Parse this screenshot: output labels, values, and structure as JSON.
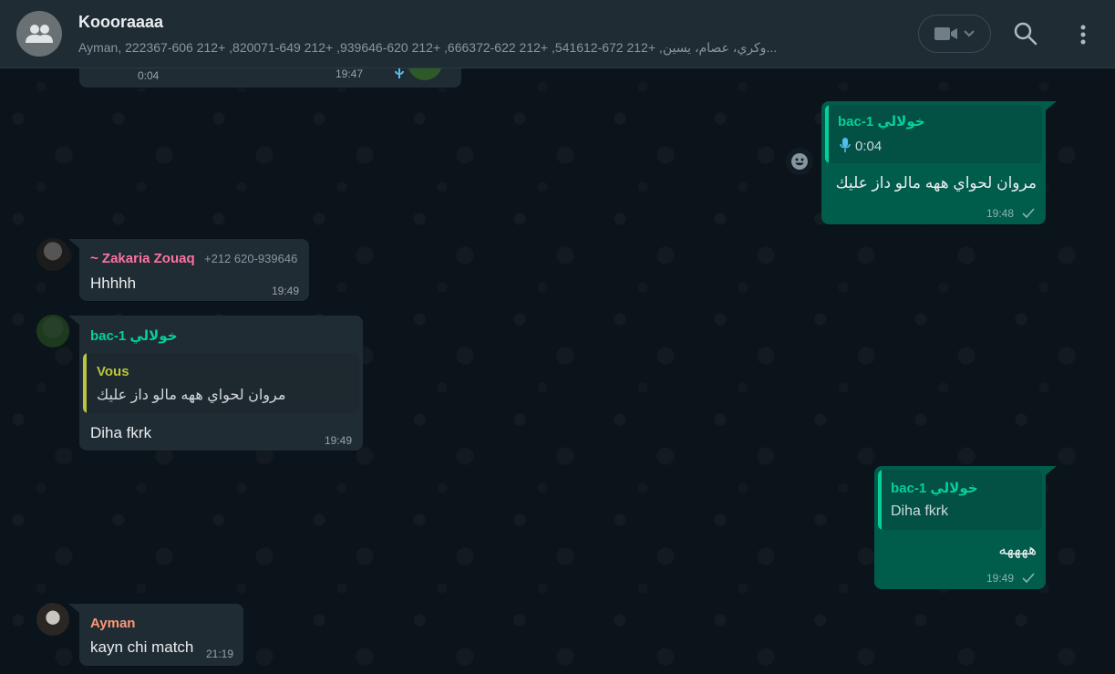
{
  "header": {
    "title": "Koooraaaa",
    "members": "Ayman, 222367-606 212+ ,820071-649 212+ ,939646-620 212+ ,666372-622 212+ ,541612-672 212+ ,وكري، عصام، يسين..."
  },
  "top_partial": {
    "duration": "0:04",
    "time": "19:47"
  },
  "messages": {
    "m1": {
      "quote_sender": "bac-1 خولالي",
      "quote_voice_duration": "0:04",
      "text": "مروان لحواي ههه مالو داز عليك",
      "time": "19:48"
    },
    "m2": {
      "sender": "~ Zakaria Zouaq",
      "phone": "+212 620-939646",
      "text": "Hhhhh",
      "time": "19:49"
    },
    "m3": {
      "sender": "bac-1 خولالي",
      "quote_sender": "Vous",
      "quote_text": "مروان لحواي ههه مالو داز عليك",
      "text": "Diha fkrk",
      "time": "19:49"
    },
    "m4": {
      "quote_sender": "bac-1 خولالي",
      "quote_text": "Diha fkrk",
      "text": "ههههه",
      "time": "19:49"
    },
    "m5": {
      "sender": "Ayman",
      "text": "kayn chi match",
      "time": "21:19"
    }
  },
  "colors": {
    "header_bg": "#202c33",
    "incoming_bubble": "#202c33",
    "outgoing_bubble": "#005c4b",
    "sender_pink": "#ff72a1",
    "sender_green": "#06cf9c",
    "sender_orange": "#fc9775",
    "quote_yellow": "#bdc53b"
  },
  "icons": [
    "group-avatar-icon",
    "video-call-icon",
    "chevron-down-icon",
    "search-icon",
    "menu-icon",
    "mic-icon",
    "check-icon"
  ]
}
